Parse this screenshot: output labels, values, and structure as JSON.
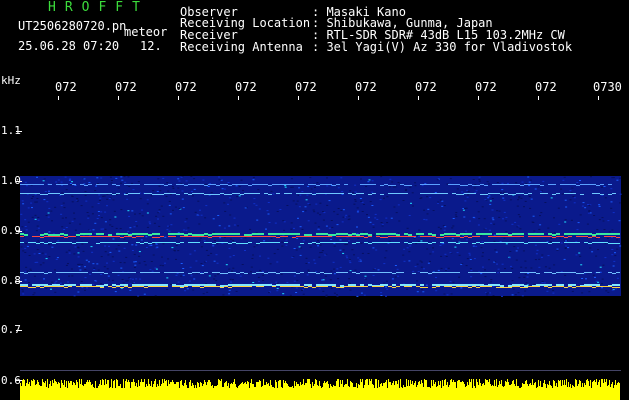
{
  "header": {
    "brand": "HROFFT",
    "file_name": "UT2506280720.pn",
    "mode": "meteor",
    "date_time": "25.06.28 07:20",
    "count": "12.",
    "fields": [
      {
        "label": "Observer",
        "value": ": Masaki Kano"
      },
      {
        "label": "Receiving Location",
        "value": ": Shibukawa, Gunma, Japan"
      },
      {
        "label": "Receiver",
        "value": ": RTL-SDR SDR# 43dB L15 103.2MHz CW"
      },
      {
        "label": "Receiving Antenna",
        "value": ": 3el Yagi(V) Az 330 for Vladivostok"
      }
    ]
  },
  "spectrogram": {
    "y_unit": "kHz",
    "y_ticks": [
      "1.1",
      "1.0",
      "0.9",
      "0.8",
      "0.7",
      "0.6"
    ],
    "x_ticks": [
      "072",
      "072",
      "072",
      "072",
      "072",
      "072",
      "072",
      "072",
      "072",
      "0730"
    ],
    "colors": {
      "background": "#000000",
      "tick": "#ffffff",
      "amplitude": "#ffff00",
      "title": "#3cdc3c"
    }
  }
}
